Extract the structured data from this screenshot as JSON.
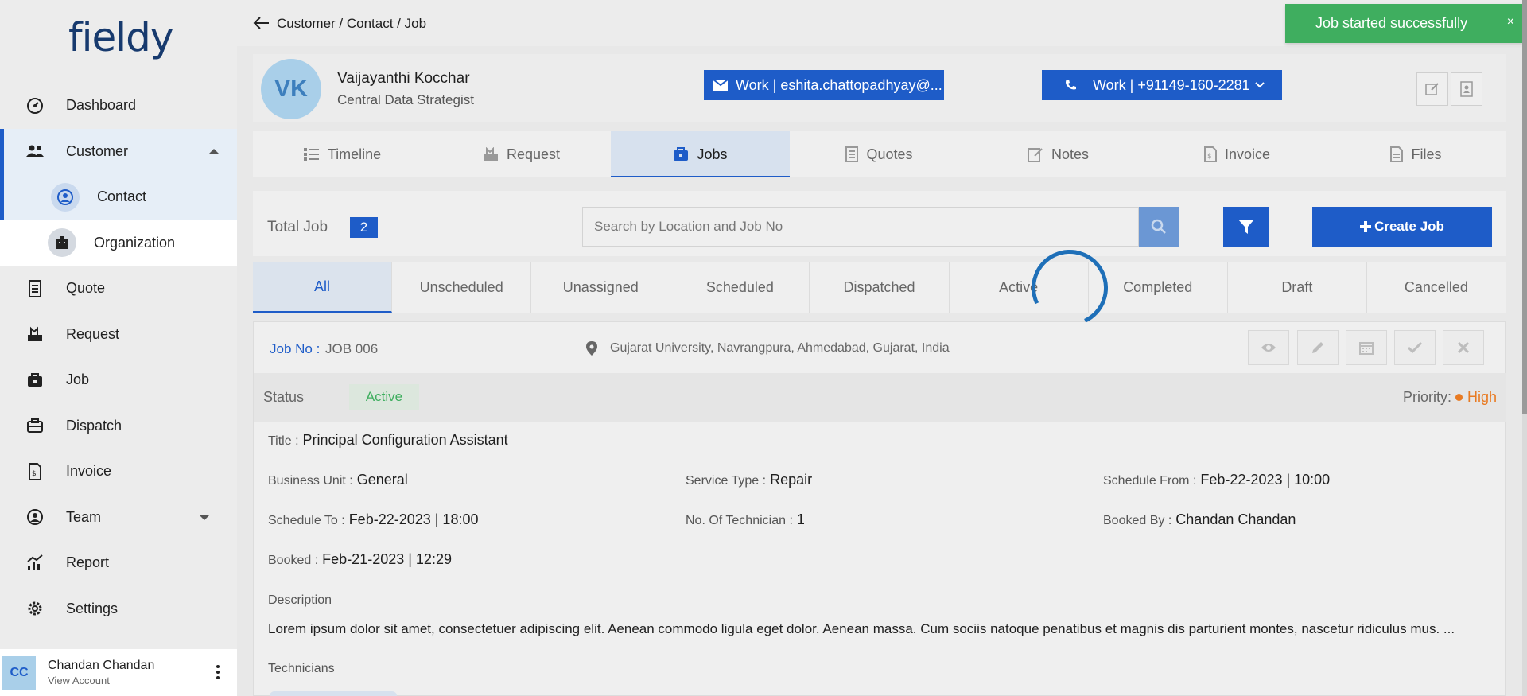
{
  "brand": {
    "logo_text": "fieldy"
  },
  "sidebar": {
    "items": [
      {
        "label": "Dashboard",
        "icon": "dashboard-icon"
      },
      {
        "label": "Customer",
        "icon": "users-icon"
      },
      {
        "label": "Quote",
        "icon": "quote-icon"
      },
      {
        "label": "Request",
        "icon": "request-icon"
      },
      {
        "label": "Job",
        "icon": "job-icon"
      },
      {
        "label": "Dispatch",
        "icon": "dispatch-icon"
      },
      {
        "label": "Invoice",
        "icon": "invoice-icon"
      },
      {
        "label": "Team",
        "icon": "team-icon"
      },
      {
        "label": "Report",
        "icon": "report-icon"
      },
      {
        "label": "Settings",
        "icon": "settings-icon"
      }
    ],
    "customer_sub": [
      {
        "label": "Contact",
        "icon": "contact-icon"
      },
      {
        "label": "Organization",
        "icon": "organization-icon"
      }
    ],
    "account": {
      "initials": "CC",
      "name": "Chandan Chandan",
      "sub": "View Account"
    }
  },
  "header": {
    "breadcrumb": "Customer / Contact / Job"
  },
  "toast": {
    "message": "Job started successfully",
    "close": "×"
  },
  "contact": {
    "initials": "VK",
    "name": "Vaijayanthi Kocchar",
    "role": "Central Data Strategist",
    "email": "Work | eshita.chattopadhyay@...",
    "phone": "Work | +91149-160-2281"
  },
  "tabs": [
    {
      "label": "Timeline"
    },
    {
      "label": "Request"
    },
    {
      "label": "Jobs"
    },
    {
      "label": "Quotes"
    },
    {
      "label": "Notes"
    },
    {
      "label": "Invoice"
    },
    {
      "label": "Files"
    }
  ],
  "toolbar": {
    "total_label": "Total Job",
    "total_count": "2",
    "search_placeholder": "Search by Location and Job No",
    "create_label": "Create Job"
  },
  "status_tabs": [
    "All",
    "Unscheduled",
    "Unassigned",
    "Scheduled",
    "Dispatched",
    "Active",
    "Completed",
    "Draft",
    "Cancelled"
  ],
  "job": {
    "no_label": "Job No :",
    "no_value": "JOB 006",
    "location": "Gujarat University, Navrangpura, Ahmedabad, Gujarat, India",
    "status_label": "Status",
    "status_value": "Active",
    "priority_label": "Priority:",
    "priority_value": "High",
    "title_label": "Title :",
    "title_value": "Principal Configuration Assistant",
    "business_unit_label": "Business Unit :",
    "business_unit_value": "General",
    "service_type_label": "Service Type :",
    "service_type_value": "Repair",
    "schedule_from_label": "Schedule From :",
    "schedule_from_value": "Feb-22-2023 | 10:00",
    "schedule_to_label": "Schedule To :",
    "schedule_to_value": "Feb-22-2023 | 18:00",
    "technicians_count_label": "No. Of Technician :",
    "technicians_count_value": "1",
    "booked_by_label": "Booked By :",
    "booked_by_value": "Chandan Chandan",
    "booked_label": "Booked :",
    "booked_value": "Feb-21-2023 | 12:29",
    "description_label": "Description",
    "description_value": "Lorem ipsum dolor sit amet, consectetuer adipiscing elit. Aenean commodo ligula eget dolor. Aenean massa. Cum sociis natoque penatibus et magnis dis parturient montes, nascetur ridiculus mus. ...",
    "technicians_label": "Technicians"
  },
  "colors": {
    "primary": "#1e5cc8",
    "success": "#3fae5f",
    "warning": "#e87a22"
  }
}
